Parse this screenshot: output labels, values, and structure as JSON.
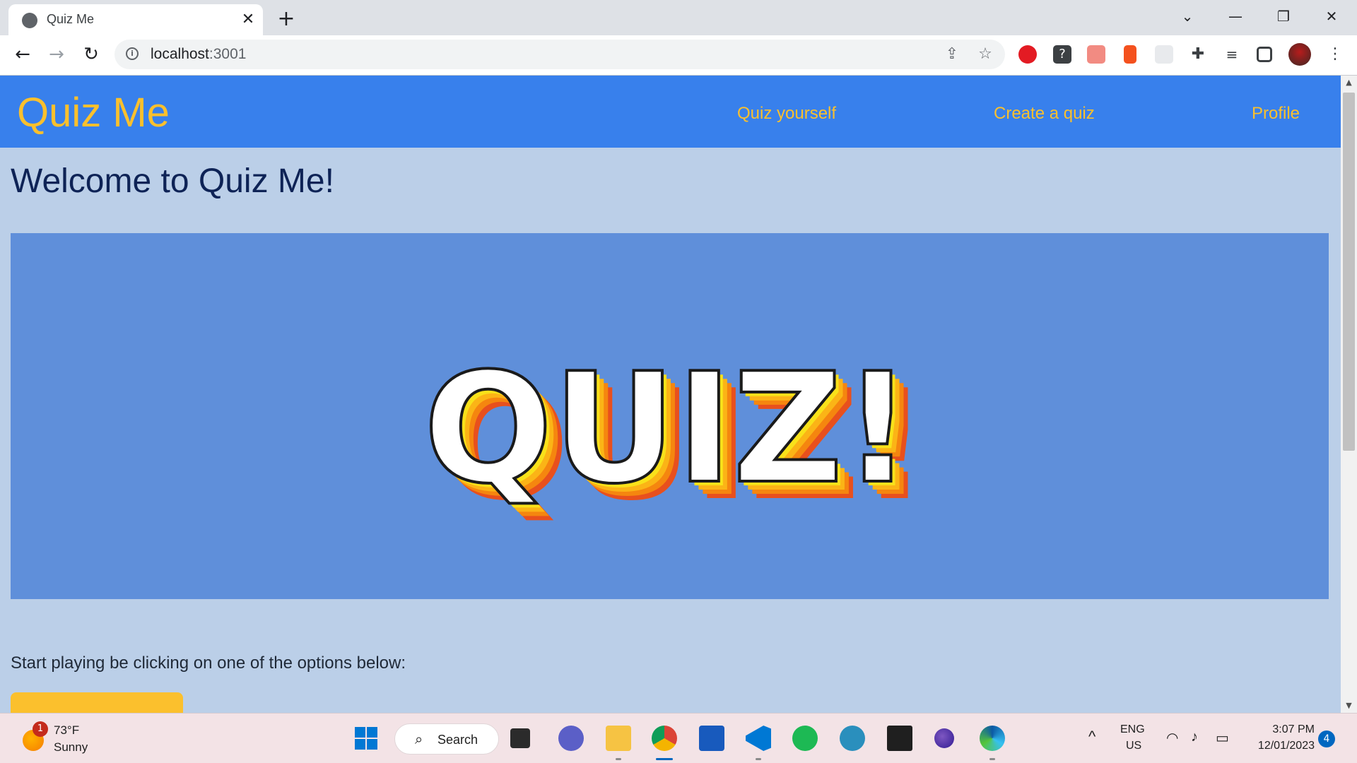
{
  "browser": {
    "tab_title": "Quiz Me",
    "tab_close_glyph": "✕",
    "new_tab_glyph": "+",
    "url_host": "localhost",
    "url_port": ":3001",
    "window_controls": [
      "⌄",
      "—",
      "❐",
      "✕"
    ],
    "extensions": [
      "opera-extension-icon",
      "question-extension-icon",
      "share-extension-icon",
      "lock-extension-icon",
      "blank-extension-icon",
      "puzzle-extensions-icon",
      "media-queue-icon",
      "side-panel-icon",
      "profile-avatar",
      "menu-icon"
    ]
  },
  "site": {
    "brand": "Quiz Me",
    "nav": {
      "quiz_yourself": "Quiz yourself",
      "create_quiz": "Create a quiz",
      "profile": "Profile"
    },
    "welcome": "Welcome to Quiz Me!",
    "hero_word": "QUIZ!",
    "instructions": "Start playing be clicking on one of the options below:"
  },
  "taskbar": {
    "weather_temp": "73°F",
    "weather_condition": "Sunny",
    "weather_badge": "1",
    "search_label": "Search",
    "lang_top": "ENG",
    "lang_bottom": "US",
    "time": "3:07 PM",
    "date": "12/01/2023",
    "notification_count": "4"
  },
  "colors": {
    "navbar": "#3880ec",
    "brand_yellow": "#fbc02d",
    "page_bg": "#bbcfe8",
    "hero_bg": "#5f8fda",
    "heading": "#0e2356"
  }
}
